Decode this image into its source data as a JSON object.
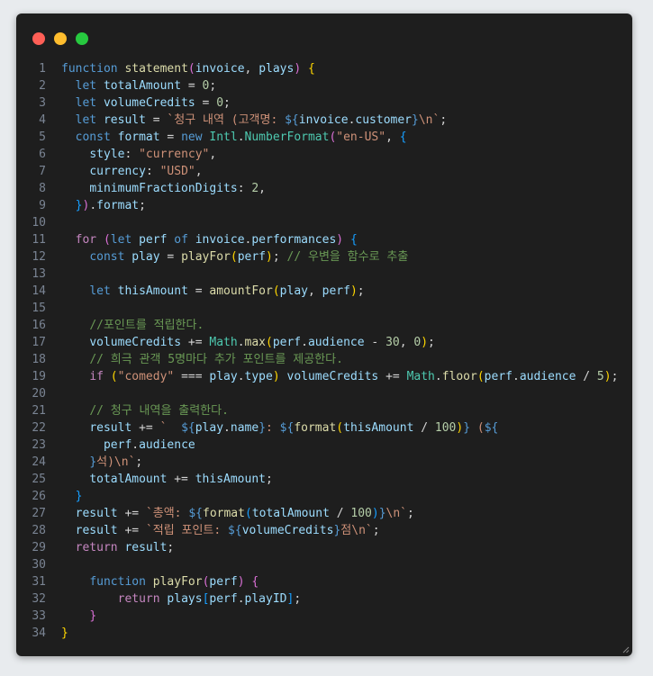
{
  "colors": {
    "background": "#e8ebee",
    "window": "#1e1e1e",
    "line_number": "#7a8493",
    "keyword": "#569cd6",
    "control": "#c586c0",
    "function": "#dcdcaa",
    "variable": "#9cdcfe",
    "type": "#4ec9b0",
    "string": "#ce9178",
    "number": "#b5cea8",
    "comment": "#6a9955",
    "punct": "#d4d4d4",
    "brace": "#ffd700",
    "paren": "#da70d6",
    "bracket": "#179fff",
    "template": "#569cd6"
  },
  "window_controls": [
    {
      "name": "close",
      "color": "#ff5f56"
    },
    {
      "name": "minimize",
      "color": "#ffbd2e"
    },
    {
      "name": "zoom",
      "color": "#27c93f"
    }
  ],
  "icons": {
    "resize": "resize-grip-icon"
  },
  "lines": [
    {
      "n": "1",
      "tokens": [
        [
          "keyword",
          "function"
        ],
        [
          "punct",
          " "
        ],
        [
          "function",
          "statement"
        ],
        [
          "paren",
          "("
        ],
        [
          "variable",
          "invoice"
        ],
        [
          "punct",
          ", "
        ],
        [
          "variable",
          "plays"
        ],
        [
          "paren",
          ")"
        ],
        [
          "punct",
          " "
        ],
        [
          "brace",
          "{"
        ]
      ]
    },
    {
      "n": "2",
      "tokens": [
        [
          "punct",
          "  "
        ],
        [
          "keyword",
          "let"
        ],
        [
          "punct",
          " "
        ],
        [
          "variable",
          "totalAmount"
        ],
        [
          "punct",
          " = "
        ],
        [
          "number",
          "0"
        ],
        [
          "punct",
          ";"
        ]
      ]
    },
    {
      "n": "3",
      "tokens": [
        [
          "punct",
          "  "
        ],
        [
          "keyword",
          "let"
        ],
        [
          "punct",
          " "
        ],
        [
          "variable",
          "volumeCredits"
        ],
        [
          "punct",
          " = "
        ],
        [
          "number",
          "0"
        ],
        [
          "punct",
          ";"
        ]
      ]
    },
    {
      "n": "4",
      "tokens": [
        [
          "punct",
          "  "
        ],
        [
          "keyword",
          "let"
        ],
        [
          "punct",
          " "
        ],
        [
          "variable",
          "result"
        ],
        [
          "punct",
          " = "
        ],
        [
          "string",
          "`청구 내역 (고객명: "
        ],
        [
          "template",
          "${"
        ],
        [
          "variable",
          "invoice"
        ],
        [
          "punct",
          "."
        ],
        [
          "variable",
          "customer"
        ],
        [
          "template",
          "}"
        ],
        [
          "string",
          "\\n`"
        ],
        [
          "punct",
          ";"
        ]
      ]
    },
    {
      "n": "5",
      "tokens": [
        [
          "punct",
          "  "
        ],
        [
          "keyword",
          "const"
        ],
        [
          "punct",
          " "
        ],
        [
          "variable",
          "format"
        ],
        [
          "punct",
          " = "
        ],
        [
          "keyword",
          "new"
        ],
        [
          "punct",
          " "
        ],
        [
          "type",
          "Intl"
        ],
        [
          "punct",
          "."
        ],
        [
          "type",
          "NumberFormat"
        ],
        [
          "paren",
          "("
        ],
        [
          "string",
          "\"en-US\""
        ],
        [
          "punct",
          ", "
        ],
        [
          "bracket",
          "{"
        ]
      ]
    },
    {
      "n": "6",
      "tokens": [
        [
          "punct",
          "    "
        ],
        [
          "variable",
          "style"
        ],
        [
          "punct",
          ": "
        ],
        [
          "string",
          "\"currency\""
        ],
        [
          "punct",
          ","
        ]
      ]
    },
    {
      "n": "7",
      "tokens": [
        [
          "punct",
          "    "
        ],
        [
          "variable",
          "currency"
        ],
        [
          "punct",
          ": "
        ],
        [
          "string",
          "\"USD\""
        ],
        [
          "punct",
          ","
        ]
      ]
    },
    {
      "n": "8",
      "tokens": [
        [
          "punct",
          "    "
        ],
        [
          "variable",
          "minimumFractionDigits"
        ],
        [
          "punct",
          ": "
        ],
        [
          "number",
          "2"
        ],
        [
          "punct",
          ","
        ]
      ]
    },
    {
      "n": "9",
      "tokens": [
        [
          "punct",
          "  "
        ],
        [
          "bracket",
          "}"
        ],
        [
          "paren",
          ")"
        ],
        [
          "punct",
          "."
        ],
        [
          "variable",
          "format"
        ],
        [
          "punct",
          ";"
        ]
      ]
    },
    {
      "n": "10",
      "tokens": []
    },
    {
      "n": "11",
      "tokens": [
        [
          "punct",
          "  "
        ],
        [
          "control",
          "for"
        ],
        [
          "punct",
          " "
        ],
        [
          "paren",
          "("
        ],
        [
          "keyword",
          "let"
        ],
        [
          "punct",
          " "
        ],
        [
          "variable",
          "perf"
        ],
        [
          "punct",
          " "
        ],
        [
          "keyword",
          "of"
        ],
        [
          "punct",
          " "
        ],
        [
          "variable",
          "invoice"
        ],
        [
          "punct",
          "."
        ],
        [
          "variable",
          "performances"
        ],
        [
          "paren",
          ")"
        ],
        [
          "punct",
          " "
        ],
        [
          "bracket",
          "{"
        ]
      ]
    },
    {
      "n": "12",
      "tokens": [
        [
          "punct",
          "    "
        ],
        [
          "keyword",
          "const"
        ],
        [
          "punct",
          " "
        ],
        [
          "variable",
          "play"
        ],
        [
          "punct",
          " = "
        ],
        [
          "function",
          "playFor"
        ],
        [
          "brace",
          "("
        ],
        [
          "variable",
          "perf"
        ],
        [
          "brace",
          ")"
        ],
        [
          "punct",
          "; "
        ],
        [
          "comment",
          "// 우변을 함수로 추출"
        ]
      ]
    },
    {
      "n": "13",
      "tokens": []
    },
    {
      "n": "14",
      "tokens": [
        [
          "punct",
          "    "
        ],
        [
          "keyword",
          "let"
        ],
        [
          "punct",
          " "
        ],
        [
          "variable",
          "thisAmount"
        ],
        [
          "punct",
          " = "
        ],
        [
          "function",
          "amountFor"
        ],
        [
          "brace",
          "("
        ],
        [
          "variable",
          "play"
        ],
        [
          "punct",
          ", "
        ],
        [
          "variable",
          "perf"
        ],
        [
          "brace",
          ")"
        ],
        [
          "punct",
          ";"
        ]
      ]
    },
    {
      "n": "15",
      "tokens": []
    },
    {
      "n": "16",
      "tokens": [
        [
          "punct",
          "    "
        ],
        [
          "comment",
          "//포인트를 적립한다."
        ]
      ]
    },
    {
      "n": "17",
      "tokens": [
        [
          "punct",
          "    "
        ],
        [
          "variable",
          "volumeCredits"
        ],
        [
          "punct",
          " += "
        ],
        [
          "type",
          "Math"
        ],
        [
          "punct",
          "."
        ],
        [
          "function",
          "max"
        ],
        [
          "brace",
          "("
        ],
        [
          "variable",
          "perf"
        ],
        [
          "punct",
          "."
        ],
        [
          "variable",
          "audience"
        ],
        [
          "punct",
          " - "
        ],
        [
          "number",
          "30"
        ],
        [
          "punct",
          ", "
        ],
        [
          "number",
          "0"
        ],
        [
          "brace",
          ")"
        ],
        [
          "punct",
          ";"
        ]
      ]
    },
    {
      "n": "18",
      "tokens": [
        [
          "punct",
          "    "
        ],
        [
          "comment",
          "// 희극 관객 5명마다 추가 포인트를 제공한다."
        ]
      ]
    },
    {
      "n": "19",
      "tokens": [
        [
          "punct",
          "    "
        ],
        [
          "control",
          "if"
        ],
        [
          "punct",
          " "
        ],
        [
          "brace",
          "("
        ],
        [
          "string",
          "\"comedy\""
        ],
        [
          "punct",
          " === "
        ],
        [
          "variable",
          "play"
        ],
        [
          "punct",
          "."
        ],
        [
          "variable",
          "type"
        ],
        [
          "brace",
          ")"
        ],
        [
          "punct",
          " "
        ],
        [
          "variable",
          "volumeCredits"
        ],
        [
          "punct",
          " += "
        ],
        [
          "type",
          "Math"
        ],
        [
          "punct",
          "."
        ],
        [
          "function",
          "floor"
        ],
        [
          "brace",
          "("
        ],
        [
          "variable",
          "perf"
        ],
        [
          "punct",
          "."
        ],
        [
          "variable",
          "audience"
        ],
        [
          "punct",
          " / "
        ],
        [
          "number",
          "5"
        ],
        [
          "brace",
          ")"
        ],
        [
          "punct",
          ";"
        ]
      ]
    },
    {
      "n": "20",
      "tokens": []
    },
    {
      "n": "21",
      "tokens": [
        [
          "punct",
          "    "
        ],
        [
          "comment",
          "// 청구 내역을 출력한다."
        ]
      ]
    },
    {
      "n": "22",
      "tokens": [
        [
          "punct",
          "    "
        ],
        [
          "variable",
          "result"
        ],
        [
          "punct",
          " += "
        ],
        [
          "string",
          "`  "
        ],
        [
          "template",
          "${"
        ],
        [
          "variable",
          "play"
        ],
        [
          "punct",
          "."
        ],
        [
          "variable",
          "name"
        ],
        [
          "template",
          "}"
        ],
        [
          "string",
          ": "
        ],
        [
          "template",
          "${"
        ],
        [
          "function",
          "format"
        ],
        [
          "brace",
          "("
        ],
        [
          "variable",
          "thisAmount"
        ],
        [
          "punct",
          " / "
        ],
        [
          "number",
          "100"
        ],
        [
          "brace",
          ")"
        ],
        [
          "template",
          "}"
        ],
        [
          "string",
          " ("
        ],
        [
          "template",
          "${"
        ]
      ]
    },
    {
      "n": "23",
      "tokens": [
        [
          "punct",
          "      "
        ],
        [
          "variable",
          "perf"
        ],
        [
          "punct",
          "."
        ],
        [
          "variable",
          "audience"
        ]
      ]
    },
    {
      "n": "24",
      "tokens": [
        [
          "punct",
          "    "
        ],
        [
          "template",
          "}"
        ],
        [
          "string",
          "석)\\n`"
        ],
        [
          "punct",
          ";"
        ]
      ]
    },
    {
      "n": "25",
      "tokens": [
        [
          "punct",
          "    "
        ],
        [
          "variable",
          "totalAmount"
        ],
        [
          "punct",
          " += "
        ],
        [
          "variable",
          "thisAmount"
        ],
        [
          "punct",
          ";"
        ]
      ]
    },
    {
      "n": "26",
      "tokens": [
        [
          "punct",
          "  "
        ],
        [
          "bracket",
          "}"
        ]
      ]
    },
    {
      "n": "27",
      "tokens": [
        [
          "punct",
          "  "
        ],
        [
          "variable",
          "result"
        ],
        [
          "punct",
          " += "
        ],
        [
          "string",
          "`총액: "
        ],
        [
          "template",
          "${"
        ],
        [
          "function",
          "format"
        ],
        [
          "bracket",
          "("
        ],
        [
          "variable",
          "totalAmount"
        ],
        [
          "punct",
          " / "
        ],
        [
          "number",
          "100"
        ],
        [
          "bracket",
          ")"
        ],
        [
          "template",
          "}"
        ],
        [
          "string",
          "\\n`"
        ],
        [
          "punct",
          ";"
        ]
      ]
    },
    {
      "n": "28",
      "tokens": [
        [
          "punct",
          "  "
        ],
        [
          "variable",
          "result"
        ],
        [
          "punct",
          " += "
        ],
        [
          "string",
          "`적립 포인트: "
        ],
        [
          "template",
          "${"
        ],
        [
          "variable",
          "volumeCredits"
        ],
        [
          "template",
          "}"
        ],
        [
          "string",
          "점\\n`"
        ],
        [
          "punct",
          ";"
        ]
      ]
    },
    {
      "n": "29",
      "tokens": [
        [
          "punct",
          "  "
        ],
        [
          "control",
          "return"
        ],
        [
          "punct",
          " "
        ],
        [
          "variable",
          "result"
        ],
        [
          "punct",
          ";"
        ]
      ]
    },
    {
      "n": "30",
      "tokens": []
    },
    {
      "n": "31",
      "tokens": [
        [
          "punct",
          "    "
        ],
        [
          "keyword",
          "function"
        ],
        [
          "punct",
          " "
        ],
        [
          "function",
          "playFor"
        ],
        [
          "paren",
          "("
        ],
        [
          "variable",
          "perf"
        ],
        [
          "paren",
          ")"
        ],
        [
          "punct",
          " "
        ],
        [
          "paren",
          "{"
        ]
      ]
    },
    {
      "n": "32",
      "tokens": [
        [
          "punct",
          "        "
        ],
        [
          "control",
          "return"
        ],
        [
          "punct",
          " "
        ],
        [
          "variable",
          "plays"
        ],
        [
          "bracket",
          "["
        ],
        [
          "variable",
          "perf"
        ],
        [
          "punct",
          "."
        ],
        [
          "variable",
          "playID"
        ],
        [
          "bracket",
          "]"
        ],
        [
          "punct",
          ";"
        ]
      ]
    },
    {
      "n": "33",
      "tokens": [
        [
          "punct",
          "    "
        ],
        [
          "paren",
          "}"
        ]
      ]
    },
    {
      "n": "34",
      "tokens": [
        [
          "brace",
          "}"
        ]
      ]
    }
  ]
}
